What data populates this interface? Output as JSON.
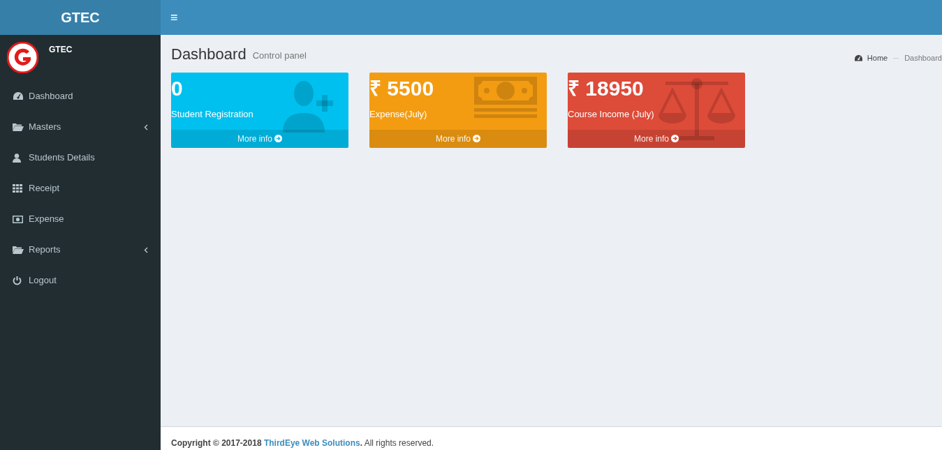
{
  "header": {
    "logo": "GTEC",
    "menu_toggle": "≡"
  },
  "user_panel": {
    "name": "GTEC"
  },
  "sidebar": {
    "items": [
      {
        "label": "Dashboard",
        "submenu": false
      },
      {
        "label": "Masters",
        "submenu": true
      },
      {
        "label": "Students Details",
        "submenu": false
      },
      {
        "label": "Receipt",
        "submenu": false
      },
      {
        "label": "Expense",
        "submenu": false
      },
      {
        "label": "Reports",
        "submenu": true
      },
      {
        "label": "Logout",
        "submenu": false
      }
    ]
  },
  "page_header": {
    "title": "Dashboard",
    "subtitle": "Control panel"
  },
  "breadcrumb": [
    "Home",
    "Dashboard"
  ],
  "cards": [
    {
      "value": "0",
      "label": "Student Registration",
      "link": "More info",
      "color": "#00c0ef"
    },
    {
      "value": "₹ 5500",
      "label": "Expense(July)",
      "link": "More info",
      "color": "#f39c12"
    },
    {
      "value": "₹ 18950",
      "label": "Course Income (July)",
      "link": "More info",
      "color": "#dd4b39"
    }
  ],
  "footer": {
    "prefix": "Copyright © 2017-2018 ",
    "link": "ThirdEye Web Solutions",
    "suffix": "**.** All rights reserved."
  }
}
